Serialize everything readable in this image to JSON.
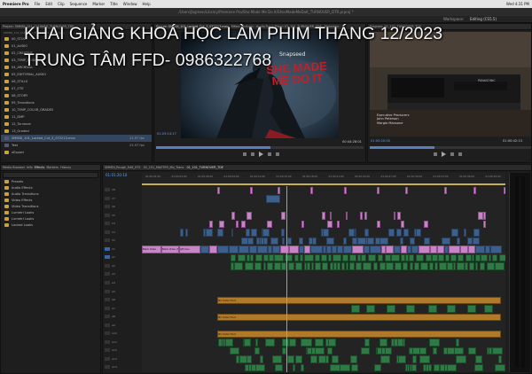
{
  "menu": {
    "app": "Premiere Pro",
    "items": [
      "File",
      "Edit",
      "Clip",
      "Sequence",
      "Marker",
      "Title",
      "Window",
      "Help"
    ],
    "clock": "Wed 4:31 PM"
  },
  "window_title": "/Users/jbgreen/Library/Premiere Pro/She Made Me Do It/ShesMadeMeDoIt_TURNOVER_DTR.prproj *",
  "workspace": {
    "label": "Workspace:",
    "value": "Editing (CS5.5)"
  },
  "project_panel": {
    "tab": "Project: SMMDI_101_CLEANED_TURNOVER_TDE",
    "path": "SMMDI_101_CLEANED_TURNOVER_TDE.prproj",
    "items_count": "27 Items",
    "items": [
      {
        "name": "00_STOCK",
        "type": "folder"
      },
      {
        "name": "01_AUDIO",
        "type": "folder"
      },
      {
        "name": "02_CREATIVE",
        "type": "folder"
      },
      {
        "name": "03_TEMP_MUSIC",
        "type": "folder"
      },
      {
        "name": "04_ARCHIVAL",
        "type": "folder"
      },
      {
        "name": "05_EDITORIAL_AUDIO",
        "type": "folder"
      },
      {
        "name": "06_STILLS",
        "type": "folder"
      },
      {
        "name": "07_OTE",
        "type": "folder"
      },
      {
        "name": "08_STORY",
        "type": "folder"
      },
      {
        "name": "09_Transitions",
        "type": "folder"
      },
      {
        "name": "10_TEMP_COLOR_GRADES",
        "type": "folder"
      },
      {
        "name": "11_DMP",
        "type": "folder"
      },
      {
        "name": "12_Turnover",
        "type": "folder"
      },
      {
        "name": "13_Graded",
        "type": "folder"
      },
      {
        "name": "SMMDI_101_Locked_Cut_3_072213.mov",
        "type": "clip",
        "fps": "23.97 fps"
      },
      {
        "name": "Test",
        "type": "clip",
        "fps": "23.97 fps"
      },
      {
        "name": "xExport",
        "type": "folder"
      }
    ]
  },
  "overlay": {
    "line1": "KHAI GIẢNG KHOÁ HỌC LÀM PHIM THÁNG 12/2023",
    "line2": "TRUNG TÂM FFD- 0986322768"
  },
  "source_monitor": {
    "tabs": [
      "Source: SMMDI_101_Locked_Cut_3_072213.mov",
      "Effect Controls",
      "Audio Track Mixer: 01_101_TURNOVER_TDE",
      "Metadata"
    ],
    "timecode_in": "01:25:14:17",
    "timecode_dur": "00:44:28:01",
    "frame_title": "SHE MADE ME DO IT",
    "watermark": "Snapseed"
  },
  "program_monitor": {
    "tab": "Program: 01_101_TURNOVER_TDE",
    "timecode": "01:00:20:00",
    "duration": "01:00:42:13",
    "credits": [
      "Executive Producers",
      "John Peterson",
      "Margie Mansone"
    ],
    "vcr_label": "PANASONIC"
  },
  "effects_panel": {
    "tabs": [
      "Media Browser",
      "Info",
      "Effects",
      "Markers",
      "History"
    ],
    "items": [
      "Presets",
      "Audio Effects",
      "Audio Transitions",
      "Video Effects",
      "Video Transitions",
      "Lumetri Looks",
      "Lumetri Looks",
      "Locked Looks"
    ]
  },
  "timeline": {
    "tabs": [
      "SMMDI_Rough_Edit_072",
      "01_101_MASTER_Mo_Trans",
      "01_101_TURNOVER_TDE"
    ],
    "timecode": "01:01:20:10",
    "ruler": [
      "01:00:01:00",
      "01:00:03:00",
      "01:00:06:00",
      "01:00:09:00",
      "01:00:12:00",
      "01:00:15:00",
      "01:00:18:00",
      "01:00:21:00",
      "01:00:24:00",
      "01:00:27:00",
      "01:00:30:00",
      "01:00:33:00",
      "01:00:36:00",
      "01:00:39:00"
    ],
    "video_tracks": [
      "V8",
      "V7",
      "V6",
      "V5",
      "V4",
      "V3",
      "V2",
      "V1"
    ],
    "audio_tracks": [
      "A1",
      "A2",
      "A3",
      "A4",
      "A5",
      "A6",
      "A7",
      "A8",
      "A9",
      "A10",
      "A11",
      "A12",
      "A13",
      "A14"
    ],
    "clip_labels": {
      "v1a": "Black Video",
      "v1b": "Black Video (50)",
      "v1c": "Jeff.mov",
      "orange1": "MX Under Hunt",
      "orange2": "MX Under Hunt",
      "orange3": "MX Under Hunt"
    }
  },
  "colors": {
    "accent": "#3d5f8c",
    "pink": "#c785c6",
    "green": "#2e7a45",
    "orange": "#b07a2a",
    "playhead": "#6aa9ff"
  }
}
